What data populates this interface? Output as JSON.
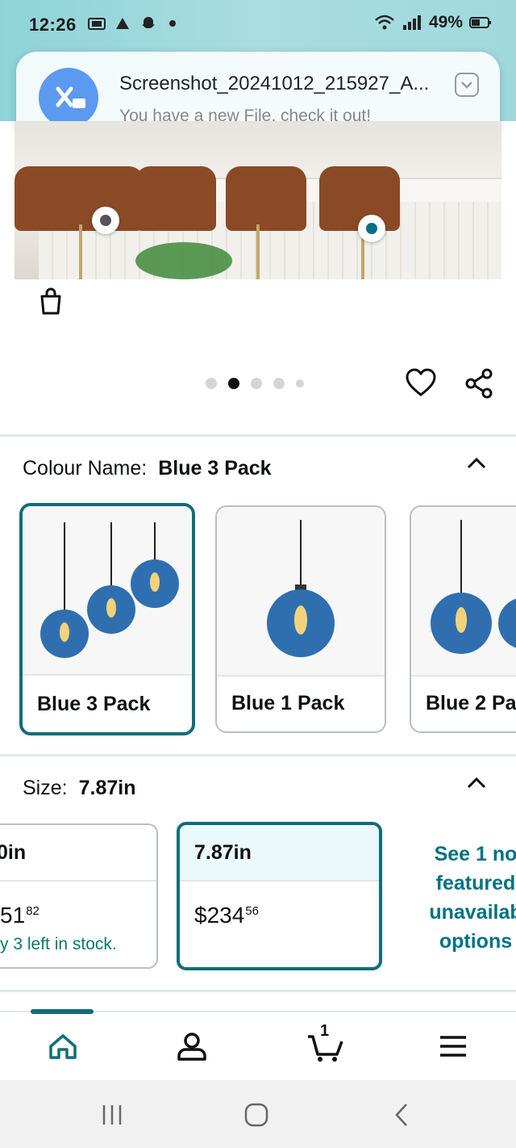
{
  "status_bar": {
    "time": "12:26",
    "battery": "49%"
  },
  "notification": {
    "title": "Screenshot_20241012_215927_A...",
    "body": "You have a new File, check it out!"
  },
  "gallery": {
    "page_count": 5,
    "active_index": 1
  },
  "colour": {
    "label": "Colour Name:",
    "value": "Blue 3 Pack",
    "options": [
      {
        "label": "Blue 3 Pack",
        "selected": true
      },
      {
        "label": "Blue 1 Pack",
        "selected": false
      },
      {
        "label": "Blue 2 Pa",
        "selected": false
      }
    ]
  },
  "size": {
    "label": "Size:",
    "value": "7.87in",
    "options": [
      {
        "label": "0in",
        "price_whole": "51",
        "price_fraction": "82",
        "stock": "y 3 left in stock."
      },
      {
        "label": "7.87in",
        "price_whole": "$234",
        "price_fraction": "56"
      }
    ],
    "see_more": "See 1 no featured unavailab options"
  },
  "bottom_nav": {
    "cart_count": "1"
  },
  "colors": {
    "accent": "#0e6e7a",
    "link": "#007185",
    "stock_green": "#067d62"
  }
}
